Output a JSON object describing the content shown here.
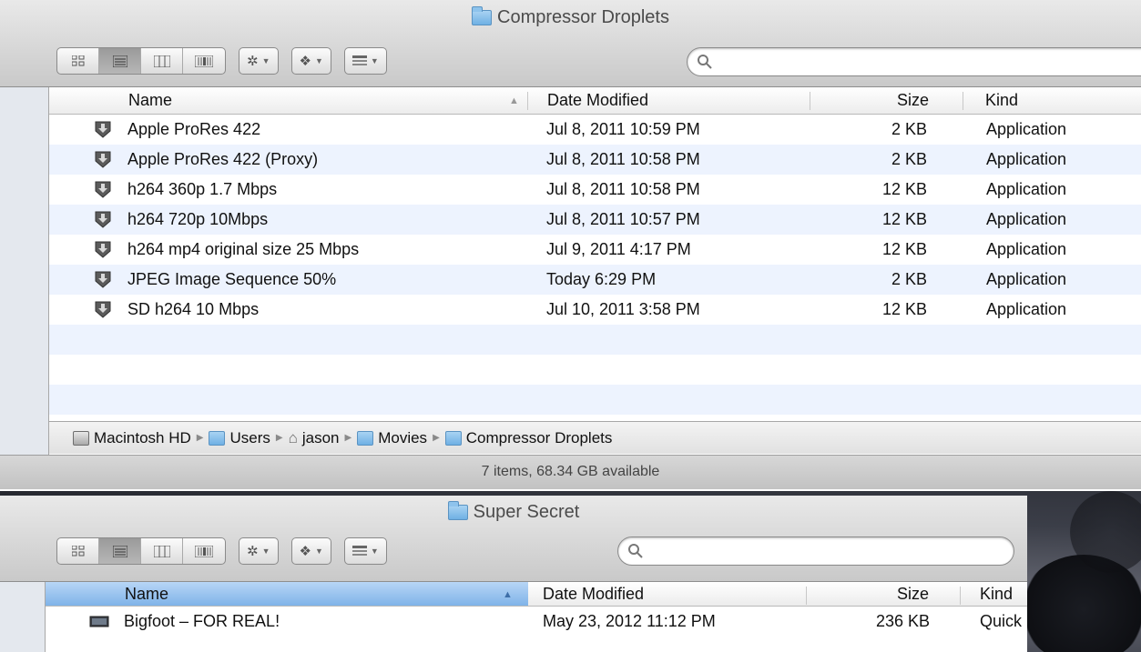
{
  "window1": {
    "title": "Compressor Droplets",
    "search": {
      "placeholder": ""
    },
    "columns": {
      "name": "Name",
      "date": "Date Modified",
      "size": "Size",
      "kind": "Kind"
    },
    "rows": [
      {
        "name": "Apple ProRes 422",
        "date": "Jul 8, 2011 10:59 PM",
        "size": "2 KB",
        "kind": "Application"
      },
      {
        "name": "Apple ProRes 422 (Proxy)",
        "date": "Jul 8, 2011 10:58 PM",
        "size": "2 KB",
        "kind": "Application"
      },
      {
        "name": "h264 360p 1.7 Mbps",
        "date": "Jul 8, 2011 10:58 PM",
        "size": "12 KB",
        "kind": "Application"
      },
      {
        "name": "h264 720p 10Mbps",
        "date": "Jul 8, 2011 10:57 PM",
        "size": "12 KB",
        "kind": "Application"
      },
      {
        "name": "h264 mp4 original size 25 Mbps",
        "date": "Jul 9, 2011 4:17 PM",
        "size": "12 KB",
        "kind": "Application"
      },
      {
        "name": "JPEG Image Sequence 50%",
        "date": "Today 6:29 PM",
        "size": "2 KB",
        "kind": "Application"
      },
      {
        "name": "SD h264 10 Mbps",
        "date": "Jul 10, 2011 3:58 PM",
        "size": "12 KB",
        "kind": "Application"
      }
    ],
    "path": [
      "Macintosh HD",
      "Users",
      "jason",
      "Movies",
      "Compressor Droplets"
    ],
    "status": "7 items, 68.34 GB available"
  },
  "window2": {
    "title": "Super Secret",
    "search": {
      "placeholder": ""
    },
    "columns": {
      "name": "Name",
      "date": "Date Modified",
      "size": "Size",
      "kind": "Kind"
    },
    "rows": [
      {
        "name": "Bigfoot – FOR REAL!",
        "date": "May 23, 2012 11:12 PM",
        "size": "236 KB",
        "kind": "Quick"
      }
    ]
  },
  "icons": {
    "view_icon": "icon-view-icon",
    "view_list": "list-view-icon",
    "view_column": "column-view-icon",
    "view_coverflow": "coverflow-view-icon",
    "action": "gear-icon",
    "dropbox": "dropbox-icon",
    "arrange": "arrange-icon",
    "search": "search-icon"
  },
  "colors": {
    "row_alt": "#edf3fe",
    "header_selected": "#8bbcec"
  }
}
